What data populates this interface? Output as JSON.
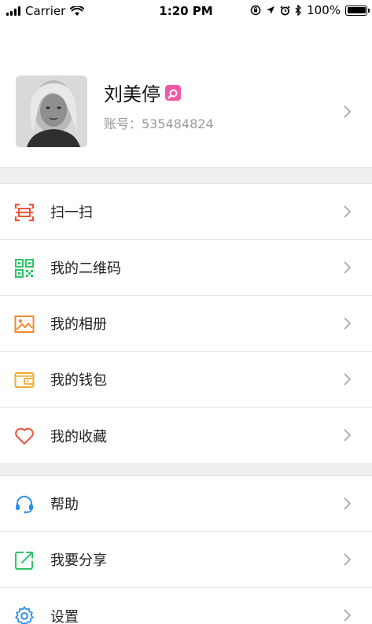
{
  "status_bar": {
    "carrier": "Carrier",
    "time": "1:20 PM",
    "battery": "100%"
  },
  "profile": {
    "name": "刘美停",
    "account_label": "账号：535484824",
    "badge_icon": "search-badge-icon",
    "badge_color": "#f05aa5"
  },
  "menu_group_1": {
    "items": [
      {
        "label": "扫一扫",
        "icon": "scan-icon",
        "color": "#f0523c"
      },
      {
        "label": "我的二维码",
        "icon": "qr-code-icon",
        "color": "#2ec56a"
      },
      {
        "label": "我的相册",
        "icon": "album-icon",
        "color": "#f08a2c"
      },
      {
        "label": "我的钱包",
        "icon": "wallet-icon",
        "color": "#f0a92c"
      },
      {
        "label": "我的收藏",
        "icon": "heart-icon",
        "color": "#f0523c"
      }
    ]
  },
  "menu_group_2": {
    "items": [
      {
        "label": "帮助",
        "icon": "headset-icon",
        "color": "#2e8ef0"
      },
      {
        "label": "我要分享",
        "icon": "share-icon",
        "color": "#2ec56a"
      },
      {
        "label": "设置",
        "icon": "settings-icon",
        "color": "#2e8ef0"
      }
    ]
  }
}
